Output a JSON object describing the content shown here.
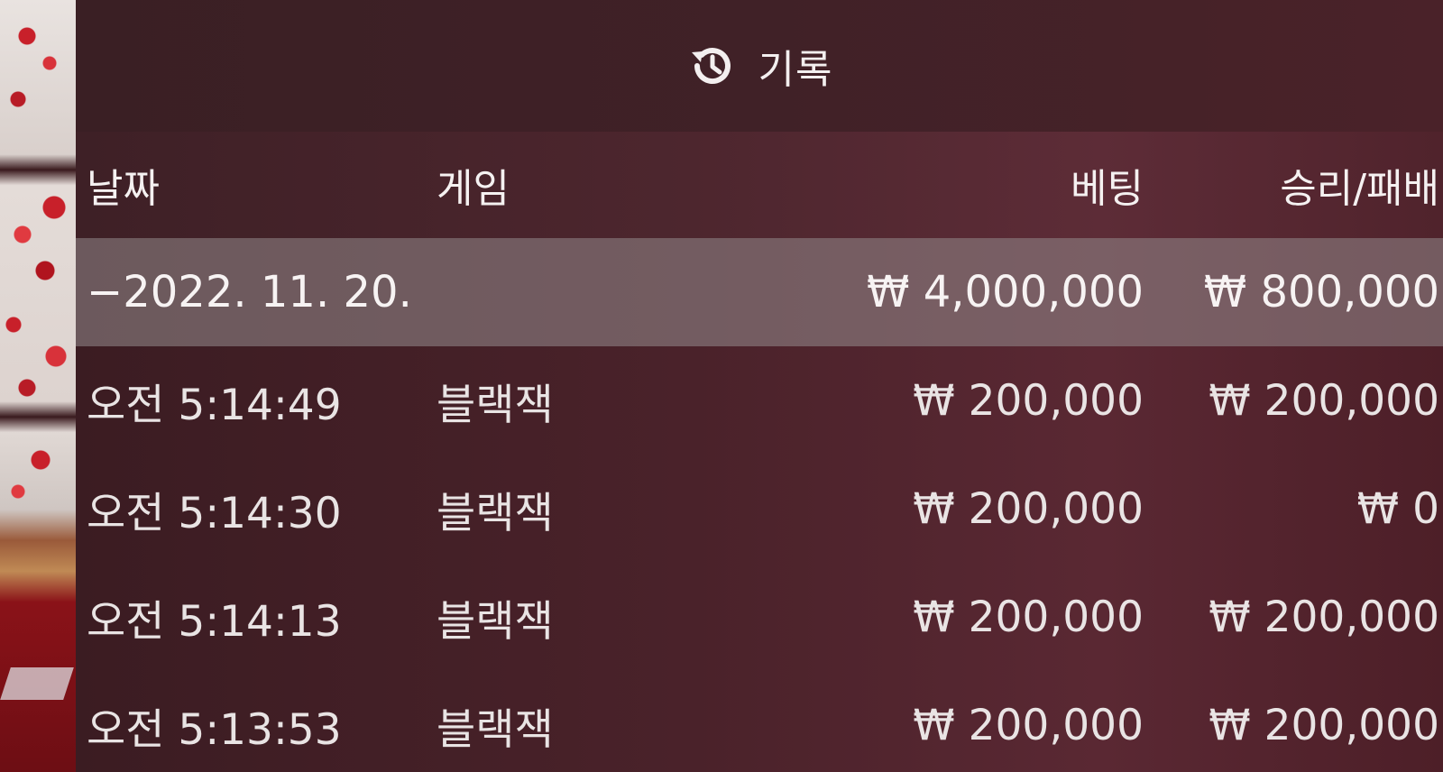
{
  "header": {
    "title": "기록",
    "icon": "history-icon"
  },
  "columns": {
    "date": "날짜",
    "game": "게임",
    "bet": "베팅",
    "win_loss": "승리/패배"
  },
  "summary": {
    "date": "−2022. 11. 20.",
    "game": "",
    "bet": "₩ 4,000,000",
    "win_loss": "₩ 800,000"
  },
  "rows": [
    {
      "time": "오전 5:14:49",
      "game": "블랙잭",
      "bet": "₩ 200,000",
      "win_loss": "₩ 200,000"
    },
    {
      "time": "오전 5:14:30",
      "game": "블랙잭",
      "bet": "₩ 200,000",
      "win_loss": "₩ 0"
    },
    {
      "time": "오전 5:14:13",
      "game": "블랙잭",
      "bet": "₩ 200,000",
      "win_loss": "₩ 200,000"
    },
    {
      "time": "오전 5:13:53",
      "game": "블랙잭",
      "bet": "₩ 200,000",
      "win_loss": "₩ 200,000"
    }
  ],
  "colors": {
    "panel_bg": "#4a222a",
    "summary_bg": "#8c8286",
    "text": "#f2eeee"
  }
}
